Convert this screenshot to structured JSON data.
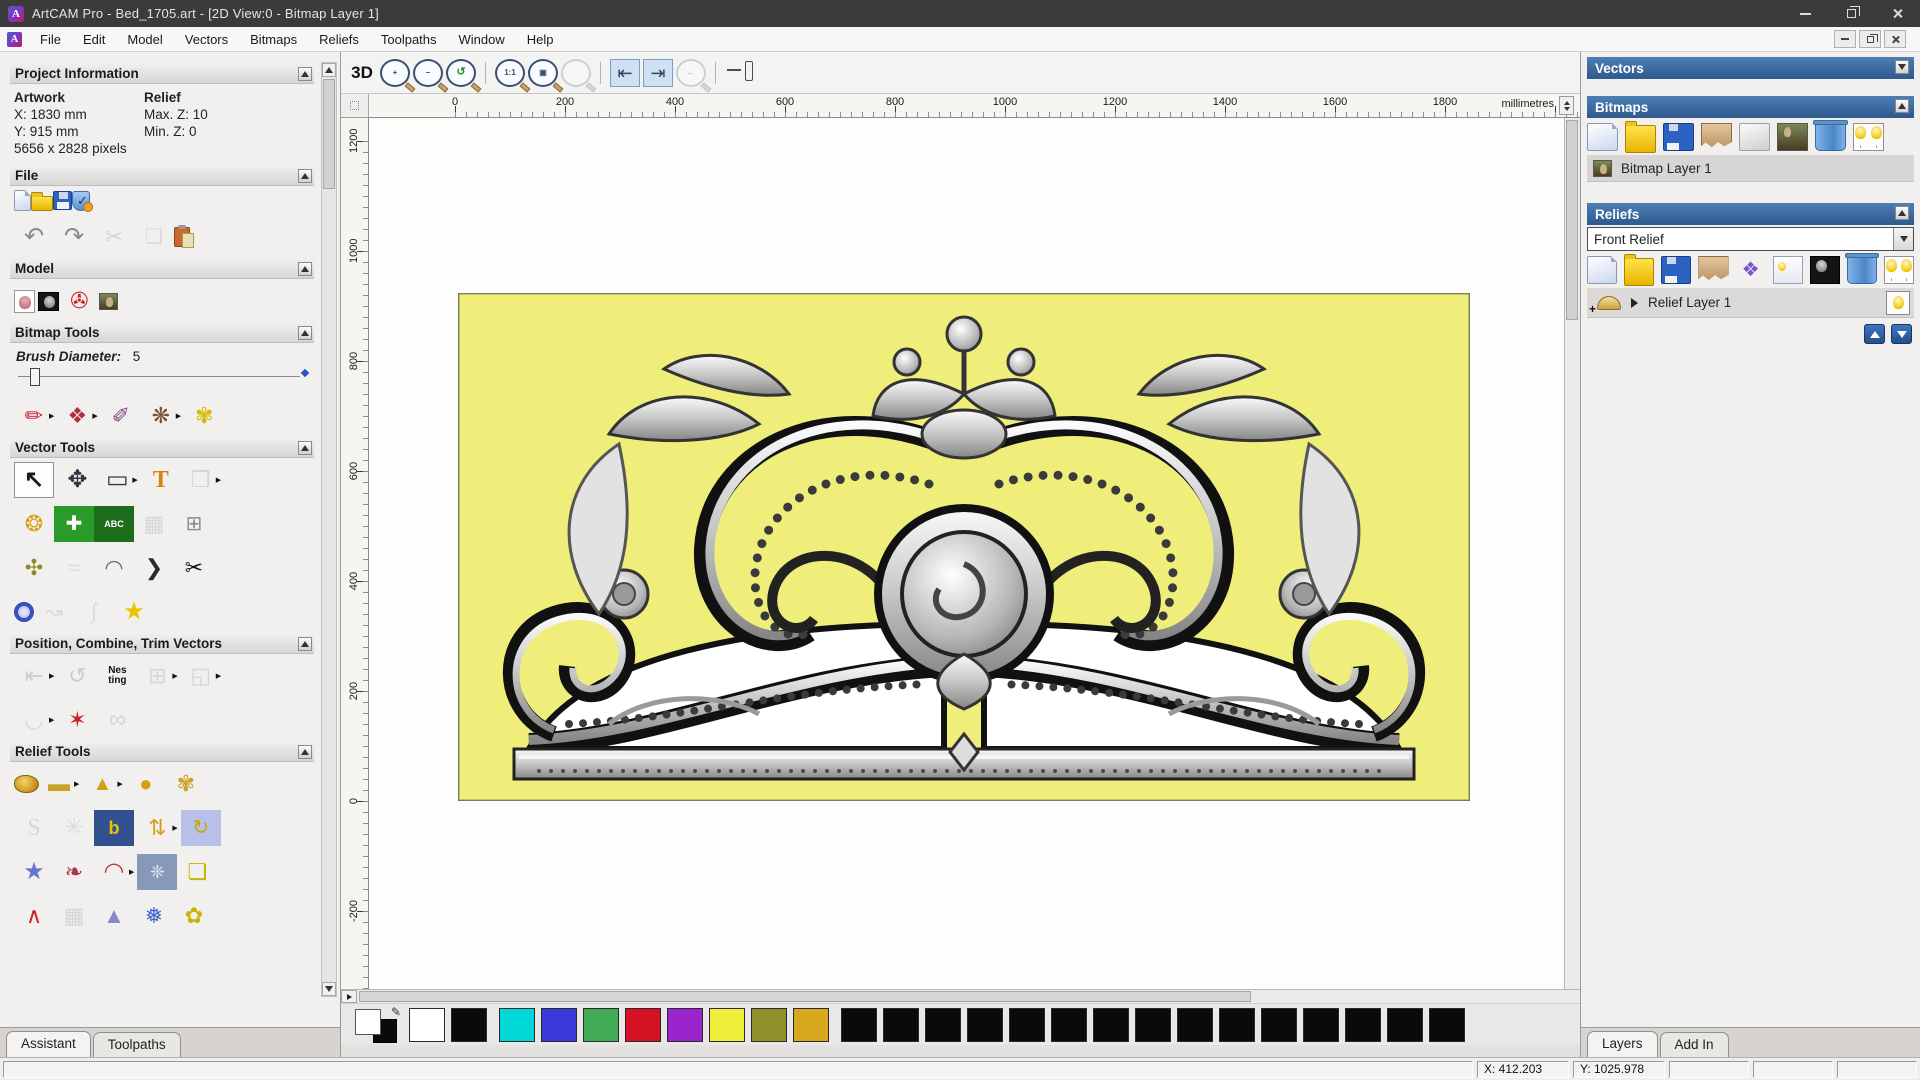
{
  "window": {
    "title": "ArtCAM Pro - Bed_1705.art - [2D View:0 - Bitmap Layer 1]"
  },
  "menu": {
    "items": [
      "File",
      "Edit",
      "Model",
      "Vectors",
      "Bitmaps",
      "Reliefs",
      "Toolpaths",
      "Window",
      "Help"
    ]
  },
  "assistant": {
    "project_information": {
      "title": "Project Information",
      "artwork_label": "Artwork",
      "relief_label": "Relief",
      "x": "X: 1830 mm",
      "y": "Y: 915 mm",
      "max_z": "Max. Z: 10",
      "min_z": "Min. Z: 0",
      "pixels": "5656 x 2828 pixels"
    },
    "section_titles": {
      "file": "File",
      "model": "Model",
      "bitmap": "Bitmap Tools",
      "vector": "Vector Tools",
      "position": "Position, Combine, Trim Vectors",
      "relief": "Relief Tools"
    },
    "brush": {
      "label": "Brush Diameter:",
      "value": "5"
    },
    "tabs": [
      "Assistant",
      "Toolpaths"
    ]
  },
  "tools": {
    "file": [
      [
        {
          "n": "new-model-button",
          "cls": "g-page"
        },
        {
          "n": "open-model-button",
          "cls": "g-folder"
        },
        {
          "n": "save-model-button",
          "cls": "g-floppy"
        },
        {
          "n": "model-options-button",
          "cls": "g-shield"
        }
      ],
      [
        {
          "n": "undo-button",
          "k": "↶",
          "c": "#8a8a8a",
          "s": 24
        },
        {
          "n": "redo-button",
          "k": "↷",
          "c": "#8a8a8a",
          "s": 24
        },
        {
          "n": "cut-button",
          "k": "✂",
          "c": "#b8b8b8",
          "s": 22,
          "dis": 1
        },
        {
          "n": "copy-button",
          "k": "❑",
          "c": "#c8c8c8",
          "s": 20,
          "dis": 1
        },
        {
          "n": "paste-button",
          "cls": "g-paste"
        }
      ]
    ],
    "model": [
      [
        {
          "n": "set-model-size-button",
          "cls": "g-bear",
          "fly": 1
        },
        {
          "n": "invert-model-button",
          "cls": "g-bear-dark"
        },
        {
          "n": "model-lighting-button",
          "k": "✇",
          "c": "#cc2222",
          "s": 22
        },
        {
          "n": "greyscale-from-image-button",
          "cls": "g-mona2"
        }
      ]
    ],
    "bitmap": [
      [
        {
          "n": "paint-button",
          "k": "✏",
          "c": "#cc2233",
          "s": 22,
          "fly": 1
        },
        {
          "n": "flood-fill-button",
          "k": "❖",
          "c": "#b03040",
          "s": 22,
          "fly": 1
        },
        {
          "n": "colour-picker-button",
          "k": "✐",
          "c": "#884488",
          "s": 22
        },
        {
          "n": "palette-button",
          "k": "❋",
          "c": "#7a5230",
          "s": 22,
          "fly": 1
        },
        {
          "n": "texture-flood-button",
          "k": "✾",
          "c": "#d8b800",
          "s": 22
        }
      ]
    ],
    "vector": [
      [
        {
          "n": "select-vectors-button",
          "k": "↖",
          "c": "#1a1a1a",
          "s": 24,
          "fw": 1,
          "act": 1,
          "fly": 1
        },
        {
          "n": "transform-vectors-button",
          "k": "✥",
          "c": "#333344",
          "s": 24
        },
        {
          "n": "create-rectangle-button",
          "k": "▭",
          "c": "#3a3a3a",
          "s": 24,
          "fly": 1
        },
        {
          "n": "create-text-button",
          "k": "T",
          "c": "#d8820a",
          "s": 24,
          "fw": 1,
          "ser": 1
        },
        {
          "n": "mirror-vectors-button",
          "k": "❒",
          "c": "#bbbbbb",
          "s": 22,
          "dis": 1,
          "fly": 1
        }
      ],
      [
        {
          "n": "measure-button",
          "k": "❂",
          "c": "#d8a012",
          "s": 22
        },
        {
          "n": "node-editing-button",
          "k": "✚",
          "c": "#ffffff",
          "bg": "#2a9a2a",
          "s": 20
        },
        {
          "n": "text-block-button",
          "k": "ABC",
          "c": "#ffffff",
          "bg": "#1d6d1d",
          "s": 9,
          "fw": 1
        },
        {
          "n": "envelope-distort-button",
          "k": "▦",
          "c": "#bfbfbf",
          "s": 22,
          "dis": 1
        },
        {
          "n": "block-copy-button",
          "k": "⊞",
          "c": "#8a8a8a",
          "s": 20
        }
      ],
      [
        {
          "n": "create-polyline-button",
          "k": "✣",
          "c": "#8a8a20",
          "s": 22
        },
        {
          "n": "free-sketch-button",
          "k": "≈",
          "c": "#c8c8c8",
          "s": 22,
          "dis": 1
        },
        {
          "n": "create-arc-button",
          "k": "◠",
          "c": "#6a6a6a",
          "s": 22
        },
        {
          "n": "create-bevel-button",
          "k": "❯",
          "c": "#2a2a2a",
          "s": 22
        },
        {
          "n": "vector-doctor-button",
          "k": "✂",
          "c": "#111111",
          "s": 22
        }
      ],
      [
        {
          "n": "create-circle-button",
          "cls": "g-circle"
        },
        {
          "n": "smooth-polyline-button",
          "k": "↝",
          "c": "#c8c8c8",
          "s": 22,
          "dis": 1
        },
        {
          "n": "fit-arcs-button",
          "k": "∫",
          "c": "#c8c8c8",
          "s": 22,
          "dis": 1
        },
        {
          "n": "create-star-button",
          "k": "★",
          "c": "#e8c400",
          "s": 24
        }
      ]
    ],
    "position": [
      [
        {
          "n": "align-vectors-button",
          "k": "⇤",
          "c": "#aaaaaa",
          "s": 22,
          "dis": 1,
          "fly": 1
        },
        {
          "n": "text-on-curve-button",
          "k": "↺",
          "c": "#aaaaaa",
          "s": 22,
          "dis": 1
        },
        {
          "n": "nesting-button",
          "k": "Nes\nting",
          "c": "#111111",
          "s": 10,
          "fw": 1
        },
        {
          "n": "weld-vectors-button",
          "k": "⊞",
          "c": "#bbbbbb",
          "s": 22,
          "dis": 1,
          "fly": 1
        },
        {
          "n": "subtract-vectors-button",
          "k": "◱",
          "c": "#bbbbbb",
          "s": 22,
          "dis": 1,
          "fly": 1
        }
      ],
      [
        {
          "n": "close-vector-button",
          "k": "◡",
          "c": "#bbbbbb",
          "s": 22,
          "dis": 1,
          "fly": 1
        },
        {
          "n": "trim-vectors-button",
          "k": "✶",
          "c": "#cc2222",
          "s": 22
        },
        {
          "n": "interlock-vectors-button",
          "k": "∞",
          "c": "#bbbbbb",
          "s": 24,
          "dis": 1
        }
      ]
    ],
    "relief": [
      [
        {
          "n": "calculate-relief-button",
          "cls": "g-gold1"
        },
        {
          "n": "zero-relief-button",
          "k": "▬",
          "c": "#c9a227",
          "s": 22,
          "fly": 1
        },
        {
          "n": "smooth-relief-button",
          "k": "▲",
          "c": "#d4a017",
          "s": 20,
          "fly": 1
        },
        {
          "n": "dome-relief-button",
          "k": "●",
          "c": "#d4a017",
          "s": 22
        },
        {
          "n": "invert-relief-button",
          "k": "✾",
          "c": "#c9a227",
          "s": 22
        }
      ],
      [
        {
          "n": "sculpt-button",
          "k": "S",
          "c": "#bbbbbb",
          "s": 24,
          "ser": 1,
          "dis": 1
        },
        {
          "n": "weave-wizard-button",
          "k": "✳",
          "c": "#cccccc",
          "s": 24,
          "dis": 1
        },
        {
          "n": "texture-relief-button",
          "k": "b",
          "c": "#e8c400",
          "bg": "#33508f",
          "s": 18,
          "fw": 1,
          "fly": 1
        },
        {
          "n": "offset-relief-button",
          "k": "⇅",
          "c": "#d4a017",
          "s": 22,
          "fly": 1
        },
        {
          "n": "rotate-relief-button",
          "k": "↻",
          "c": "#c8a800",
          "bg": "#b8c0e8",
          "s": 20
        }
      ],
      [
        {
          "n": "star-wizard-button",
          "k": "★",
          "c": "#6677cc",
          "s": 24
        },
        {
          "n": "relief-clipart-button",
          "k": "❧",
          "c": "#aa3344",
          "s": 22
        },
        {
          "n": "two-rail-sweep-button",
          "k": "◠",
          "c": "#bb3333",
          "s": 24,
          "fly": 1
        },
        {
          "n": "emboss-wizard-button",
          "k": "❈",
          "c": "#e0e8f0",
          "bg": "#8898b8",
          "s": 18
        },
        {
          "n": "extrude-button",
          "k": "❏",
          "c": "#c8b400",
          "s": 22
        }
      ],
      [
        {
          "n": "turn-wizard-button",
          "k": "∧",
          "c": "#cc2222",
          "s": 22
        },
        {
          "n": "basket-weave-button",
          "k": "▦",
          "c": "#bbbbbb",
          "s": 22,
          "dis": 1
        },
        {
          "n": "pyramid-button",
          "k": "▲",
          "c": "#8888cc",
          "s": 22
        },
        {
          "n": "texture-dome-button",
          "k": "❅",
          "c": "#4466cc",
          "s": 22
        },
        {
          "n": "fan-relief-button",
          "k": "✿",
          "c": "#c8b400",
          "s": 22
        }
      ]
    ],
    "view_toolbar": [
      [
        {
          "n": "view-3d-button",
          "k": "3D",
          "c": "#111111",
          "s": 17,
          "fw": 1
        },
        {
          "n": "zoom-in-button",
          "cls": "g-mag",
          "k": "+"
        },
        {
          "n": "zoom-out-button",
          "cls": "g-mag",
          "k": "−"
        },
        {
          "n": "zoom-previous-button",
          "cls": "g-mag g-mag-green",
          "k": "↺"
        },
        {
          "sep": 1
        },
        {
          "n": "zoom-1to1-button",
          "cls": "g-mag",
          "k": "1:1"
        },
        {
          "n": "zoom-fit-button",
          "cls": "g-mag",
          "k": "▣"
        },
        {
          "n": "zoom-selected-button",
          "cls": "g-mag g-mag-dis",
          "k": " ",
          "dis": 1
        },
        {
          "sep": 1
        },
        {
          "n": "snap-grid-left-button",
          "k": "⇤",
          "c": "#33435f",
          "s": 18,
          "press": 1
        },
        {
          "n": "snap-grid-right-button",
          "k": "⇥",
          "c": "#33435f",
          "s": 18,
          "press": 1
        },
        {
          "n": "zoom-drag-button",
          "cls": "g-mag g-mag-dis",
          "k": "←",
          "dis": 1
        },
        {
          "sep": 1
        },
        {
          "n": "zoom-slider",
          "cls": "g-slider"
        }
      ]
    ],
    "bitmaps_bar": [
      [
        {
          "n": "new-bitmap-layer-button",
          "cls": "g-page"
        },
        {
          "n": "open-bitmap-layer-button",
          "cls": "g-folder"
        },
        {
          "n": "save-bitmap-layer-button",
          "cls": "g-floppy"
        },
        {
          "n": "merge-bitmap-layers-button",
          "cls": "g-torn"
        },
        {
          "n": "blank-bitmap-layer-button",
          "cls": "g-page-grey"
        },
        {
          "n": "bitmap-to-layer-button",
          "cls": "g-mona2"
        },
        {
          "n": "delete-bitmap-layer-button",
          "cls": "g-trash"
        },
        {
          "n": "toggle-bitmap-visibility-button",
          "cls": "g-bulbs",
          "act": 1
        }
      ]
    ],
    "reliefs_bar": [
      [
        {
          "n": "new-relief-layer-button",
          "cls": "g-page"
        },
        {
          "n": "open-relief-layer-button",
          "cls": "g-folder"
        },
        {
          "n": "save-relief-layer-button",
          "cls": "g-floppy"
        },
        {
          "n": "merge-relief-layers-button",
          "cls": "g-torn"
        },
        {
          "n": "transfer-relief-button",
          "k": "❖",
          "c": "#7755cc",
          "s": 20
        },
        {
          "n": "preview-relief-layer-button",
          "cls": "g-bulbpage"
        },
        {
          "n": "greyscale-from-relief-button",
          "cls": "g-bear-dark"
        },
        {
          "n": "delete-relief-layer-button",
          "cls": "g-trash"
        },
        {
          "n": "toggle-relief-visibility-button",
          "cls": "g-bulbs",
          "act": 1
        }
      ]
    ]
  },
  "rulers": {
    "horizontal": [
      "0",
      "200",
      "400",
      "600",
      "800",
      "1000",
      "1200",
      "1400",
      "1600",
      "1800"
    ],
    "vertical": [
      "1200",
      "1000",
      "800",
      "600",
      "400",
      "200",
      "0",
      "-200"
    ],
    "units": "millimetres"
  },
  "canvas": {
    "artwork_background": "#F0EE7B"
  },
  "palette": {
    "groups": [
      [
        "#ffffff",
        "#0a0a0a"
      ],
      [
        "#00d7d7",
        "#3a3ad8",
        "#41ab55",
        "#d41224",
        "#9b24cc",
        "#efef3a",
        "#90902a",
        "#d8a81f"
      ],
      [
        "#0a0a0a",
        "#0a0a0a",
        "#0a0a0a",
        "#0a0a0a",
        "#0a0a0a",
        "#0a0a0a",
        "#0a0a0a",
        "#0a0a0a",
        "#0a0a0a",
        "#0a0a0a",
        "#0a0a0a",
        "#0a0a0a",
        "#0a0a0a",
        "#0a0a0a",
        "#0a0a0a"
      ]
    ]
  },
  "right_panel": {
    "vectors_title": "Vectors",
    "bitmaps_title": "Bitmaps",
    "bitmap_layer_label": "Bitmap Layer 1",
    "reliefs_title": "Reliefs",
    "relief_set_selected": "Front Relief",
    "relief_layer_label": "Relief Layer 1",
    "tabs": [
      "Layers",
      "Add In"
    ]
  },
  "status": {
    "x": "X: 412.203",
    "y": "Y: 1025.978"
  }
}
